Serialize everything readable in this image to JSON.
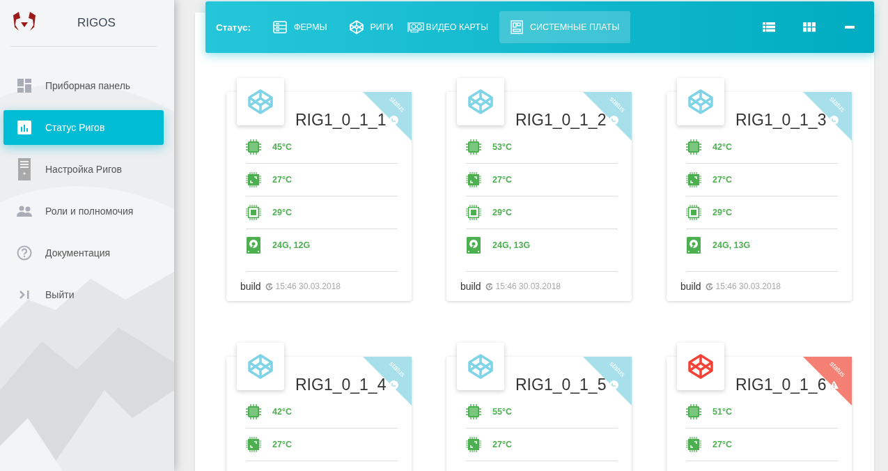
{
  "brand": {
    "name": "RIGOS"
  },
  "sidebar": {
    "items": [
      {
        "label": "Приборная панель",
        "kind": "dashboard",
        "selected": false
      },
      {
        "label": "Статус Ригов",
        "kind": "chart",
        "selected": true
      },
      {
        "label": "Настройка Ригов",
        "kind": "server",
        "selected": false
      },
      {
        "label": "Роли и полномочия",
        "kind": "people",
        "selected": false
      },
      {
        "label": "Документация",
        "kind": "help",
        "selected": false
      },
      {
        "label": "Выйти",
        "kind": "exit",
        "selected": false
      }
    ]
  },
  "toolbar": {
    "label": "Статус:",
    "tabs": [
      {
        "label": "ФЕРМЫ",
        "kind": "farms",
        "selected": false
      },
      {
        "label": "РИГИ",
        "kind": "rigs",
        "selected": false
      },
      {
        "label": "ВИДЕО КАРТЫ",
        "kind": "gpu",
        "selected": false
      },
      {
        "label": "СИСТЕМНЫЕ ПЛАТЫ",
        "kind": "board",
        "selected": true
      }
    ],
    "view_buttons": [
      {
        "kind": "list"
      },
      {
        "kind": "grid"
      },
      {
        "kind": "minimize"
      }
    ]
  },
  "rigs": [
    {
      "name": "RIG1_0_1_1",
      "alert": false,
      "status_label": "status",
      "metrics": [
        {
          "kind": "cpu",
          "value": "45°C"
        },
        {
          "kind": "gpu",
          "value": "27°C"
        },
        {
          "kind": "chip",
          "value": "29°C"
        },
        {
          "kind": "disk",
          "value": "24G, 12G"
        }
      ],
      "build_label": "build",
      "build_time": "15:46 30.03.2018"
    },
    {
      "name": "RIG1_0_1_2",
      "alert": false,
      "status_label": "status",
      "metrics": [
        {
          "kind": "cpu",
          "value": "53°C"
        },
        {
          "kind": "gpu",
          "value": "27°C"
        },
        {
          "kind": "chip",
          "value": "29°C"
        },
        {
          "kind": "disk",
          "value": "24G, 13G"
        }
      ],
      "build_label": "build",
      "build_time": "15:46 30.03.2018"
    },
    {
      "name": "RIG1_0_1_3",
      "alert": false,
      "status_label": "status",
      "metrics": [
        {
          "kind": "cpu",
          "value": "42°C"
        },
        {
          "kind": "gpu",
          "value": "27°C"
        },
        {
          "kind": "chip",
          "value": "29°C"
        },
        {
          "kind": "disk",
          "value": "24G, 13G"
        }
      ],
      "build_label": "build",
      "build_time": "15:46 30.03.2018"
    },
    {
      "name": "RIG1_0_1_4",
      "alert": false,
      "status_label": "status",
      "metrics": [
        {
          "kind": "cpu",
          "value": "42°C"
        },
        {
          "kind": "gpu",
          "value": "27°C"
        }
      ]
    },
    {
      "name": "RIG1_0_1_5",
      "alert": false,
      "status_label": "status",
      "metrics": [
        {
          "kind": "cpu",
          "value": "55°C"
        },
        {
          "kind": "gpu",
          "value": "27°C"
        }
      ]
    },
    {
      "name": "RIG1_0_1_6",
      "alert": true,
      "status_label": "status",
      "metrics": [
        {
          "kind": "cpu",
          "value": "51°C"
        },
        {
          "kind": "gpu",
          "value": "27°C"
        }
      ]
    }
  ]
}
